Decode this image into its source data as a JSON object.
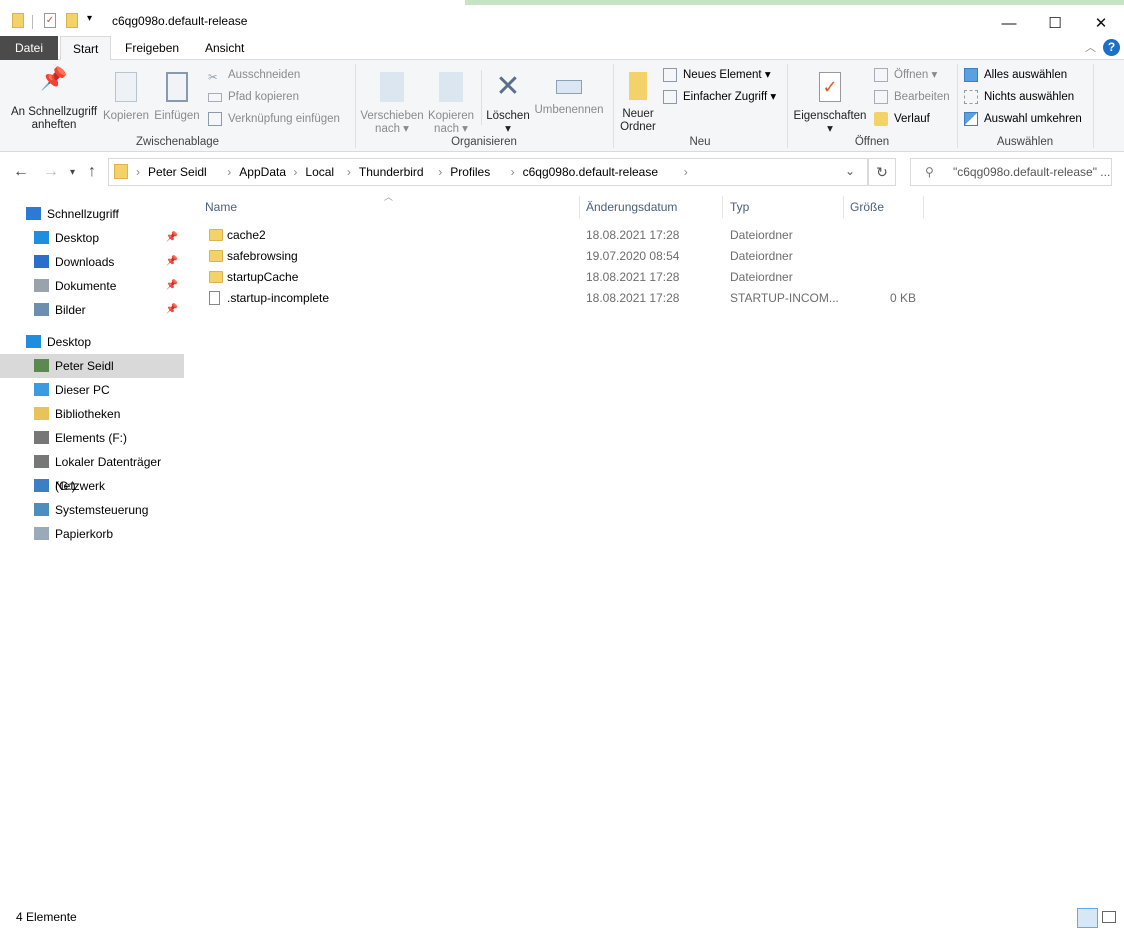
{
  "window": {
    "title": "c6qg098o.default-release",
    "minimize": "—",
    "maximize": "☐",
    "close": "✕"
  },
  "tabs": [
    "Datei",
    "Start",
    "Freigeben",
    "Ansicht"
  ],
  "ribbon": {
    "zwischenablage": {
      "label": "Zwischenablage",
      "pin": "An Schnellzugriff anheften",
      "copy": "Kopieren",
      "paste": "Einfügen",
      "cut": "Ausschneiden",
      "copy_path": "Pfad kopieren",
      "paste_link": "Verknüpfung einfügen"
    },
    "organisieren": {
      "label": "Organisieren",
      "move": "Verschieben nach",
      "copy_to": "Kopieren nach",
      "delete": "Löschen",
      "rename": "Umbenennen"
    },
    "neu": {
      "label": "Neu",
      "new_folder": "Neuer Ordner",
      "new_item": "Neues Element",
      "easy_access": "Einfacher Zugriff"
    },
    "oeffnen": {
      "label": "Öffnen",
      "properties": "Eigenschaften",
      "open": "Öffnen",
      "edit": "Bearbeiten",
      "history": "Verlauf"
    },
    "auswaehlen": {
      "label": "Auswählen",
      "select_all": "Alles auswählen",
      "select_none": "Nichts auswählen",
      "invert": "Auswahl umkehren"
    }
  },
  "address": {
    "crumbs": [
      "Peter Seidl",
      "AppData",
      "Local",
      "Thunderbird",
      "Profiles",
      "c6qg098o.default-release"
    ],
    "search_placeholder": "\"c6qg098o.default-release\" ..."
  },
  "sidebar": [
    {
      "label": "Schnellzugriff",
      "color": "#2b7bd6"
    },
    {
      "label": "Desktop",
      "color": "#1f8ee0",
      "pin": true
    },
    {
      "label": "Downloads",
      "color": "#2a6fc9",
      "pin": true
    },
    {
      "label": "Dokumente",
      "color": "#9aa3ad",
      "pin": true
    },
    {
      "label": "Bilder",
      "color": "#6c8fb0",
      "pin": true
    },
    {
      "label": "Desktop",
      "color": "#1f8ee0"
    },
    {
      "label": "Peter Seidl",
      "color": "#5a8a50",
      "selected": true
    },
    {
      "label": "Dieser PC",
      "color": "#3a9be0"
    },
    {
      "label": "Bibliotheken",
      "color": "#e9c25a"
    },
    {
      "label": "Elements (F:)",
      "color": "#777"
    },
    {
      "label": "Lokaler Datenträger (G:)",
      "color": "#777"
    },
    {
      "label": "Netzwerk",
      "color": "#3c7fc4"
    },
    {
      "label": "Systemsteuerung",
      "color": "#4c8fbf"
    },
    {
      "label": "Papierkorb",
      "color": "#9ab"
    }
  ],
  "columns": [
    "Name",
    "Änderungsdatum",
    "Typ",
    "Größe"
  ],
  "files": [
    {
      "name": "cache2",
      "date": "18.08.2021 17:28",
      "type": "Dateiordner",
      "size": "",
      "folder": true
    },
    {
      "name": "safebrowsing",
      "date": "19.07.2020 08:54",
      "type": "Dateiordner",
      "size": "",
      "folder": true
    },
    {
      "name": "startupCache",
      "date": "18.08.2021 17:28",
      "type": "Dateiordner",
      "size": "",
      "folder": true
    },
    {
      "name": ".startup-incomplete",
      "date": "18.08.2021 17:28",
      "type": "STARTUP-INCOM...",
      "size": "0 KB",
      "folder": false
    }
  ],
  "status": {
    "count": "4 Elemente"
  }
}
